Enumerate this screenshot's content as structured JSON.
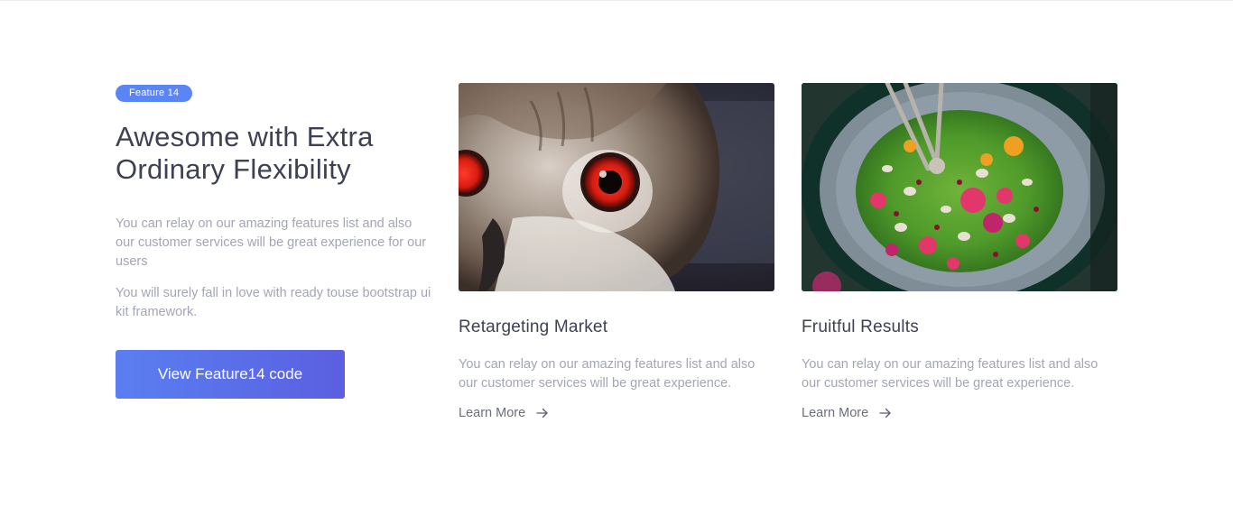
{
  "intro": {
    "badge": "Feature 14",
    "heading_line1": "Awesome with Extra",
    "heading_line2": "Ordinary Flexibility",
    "paragraph1": "You can relay on our amazing features list and also our customer services will be great experience for our users",
    "paragraph2": "You will surely fall in love with ready touse bootstrap ui kit framework.",
    "cta_label": "View Feature14 code"
  },
  "cards": [
    {
      "image": "owl-photo",
      "title": "Retargeting Market",
      "text": "You can relay on our amazing features list and also our customer services will be great experience.",
      "link_label": "Learn More",
      "link_icon": "arrow-right-icon"
    },
    {
      "image": "salad-bowl-photo",
      "title": "Fruitful Results",
      "text": "You can relay on our amazing features list and also our customer services will be great experience.",
      "link_label": "Learn More",
      "link_icon": "arrow-right-icon"
    }
  ],
  "colors": {
    "accent": "#5b84f4",
    "button_gradient_start": "#5a7ff1",
    "button_gradient_end": "#5b5fe0",
    "heading": "#3e4153",
    "body_text": "#a3a6b4"
  }
}
